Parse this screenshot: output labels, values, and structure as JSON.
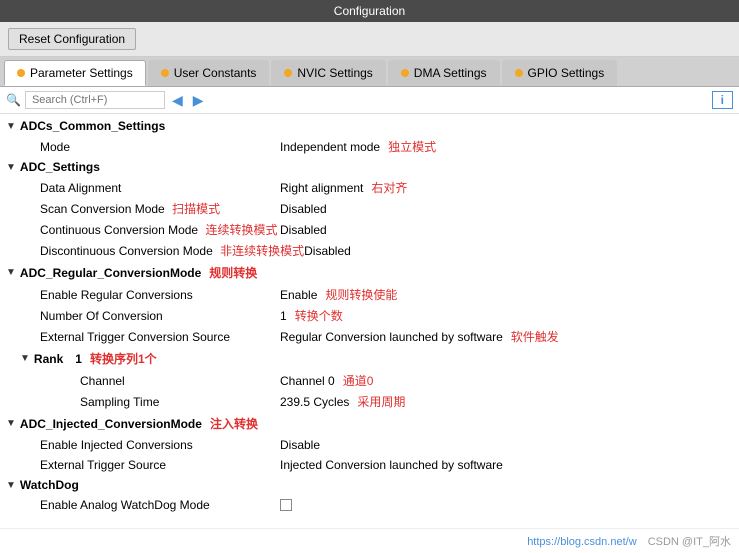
{
  "title_bar": {
    "label": "Configuration"
  },
  "toolbar": {
    "reset_btn": "Reset Configuration"
  },
  "tabs": [
    {
      "id": "parameter",
      "label": "Parameter Settings",
      "dot": "orange",
      "active": true
    },
    {
      "id": "user",
      "label": "User Constants",
      "dot": "orange",
      "active": false
    },
    {
      "id": "nvic",
      "label": "NVIC Settings",
      "dot": "orange",
      "active": false
    },
    {
      "id": "dma",
      "label": "DMA Settings",
      "dot": "orange",
      "active": false
    },
    {
      "id": "gpio",
      "label": "GPIO Settings",
      "dot": "orange",
      "active": false
    }
  ],
  "search": {
    "placeholder": "Search (Ctrl+F)"
  },
  "info_btn": "i",
  "sections": [
    {
      "id": "adc_common",
      "label": "ADCs_Common_Settings",
      "label_cn": "",
      "collapsed": false,
      "rows": [
        {
          "label": "Mode",
          "label_cn": "",
          "value": "Independent mode",
          "value_cn": "独立模式"
        }
      ]
    },
    {
      "id": "adc_settings",
      "label": "ADC_Settings",
      "label_cn": "",
      "collapsed": false,
      "rows": [
        {
          "label": "Data Alignment",
          "label_cn": "",
          "value": "Right alignment",
          "value_cn": "右对齐"
        },
        {
          "label": "Scan Conversion Mode",
          "label_cn": "扫描模式",
          "value": "Disabled",
          "value_cn": ""
        },
        {
          "label": "Continuous Conversion Mode",
          "label_cn": "连续转换模式",
          "value": "Disabled",
          "value_cn": ""
        },
        {
          "label": "Discontinuous Conversion Mode",
          "label_cn": "非连续转换模式",
          "value": "Disabled",
          "value_cn": ""
        }
      ]
    },
    {
      "id": "adc_regular",
      "label": "ADC_Regular_ConversionMode",
      "label_cn": "规则转换",
      "collapsed": false,
      "rows": [
        {
          "label": "Enable Regular Conversions",
          "label_cn": "",
          "value": "Enable",
          "value_cn": "规则转换使能"
        },
        {
          "label": "Number Of Conversion",
          "label_cn": "",
          "value": "1",
          "value_cn": "转换个数"
        },
        {
          "label": "External Trigger Conversion Source",
          "label_cn": "",
          "value": "Regular Conversion launched by software",
          "value_cn": "软件触发"
        }
      ]
    },
    {
      "id": "rank",
      "label": "Rank",
      "label_cn": "",
      "indent": true,
      "collapsed": false,
      "value": "1",
      "value_cn": "转换序列1个",
      "rows": [
        {
          "label": "Channel",
          "label_cn": "",
          "value": "Channel 0",
          "value_cn": "通道0"
        },
        {
          "label": "Sampling Time",
          "label_cn": "",
          "value": "239.5 Cycles",
          "value_cn": "采用周期"
        }
      ]
    },
    {
      "id": "adc_injected",
      "label": "ADC_Injected_ConversionMode",
      "label_cn": "注入转换",
      "collapsed": false,
      "rows": [
        {
          "label": "Enable Injected Conversions",
          "label_cn": "",
          "value": "Disable",
          "value_cn": ""
        },
        {
          "label": "External Trigger Source",
          "label_cn": "",
          "value": "Injected Conversion launched by software",
          "value_cn": ""
        }
      ]
    },
    {
      "id": "watchdog",
      "label": "WatchDog",
      "label_cn": "",
      "collapsed": false,
      "rows": [
        {
          "label": "Enable Analog WatchDog Mode",
          "label_cn": "",
          "value": "checkbox",
          "value_cn": ""
        }
      ]
    }
  ],
  "watermark": {
    "url_text": "https://blog.csdn.net/w",
    "author": "CSDN @IT_阿水"
  }
}
